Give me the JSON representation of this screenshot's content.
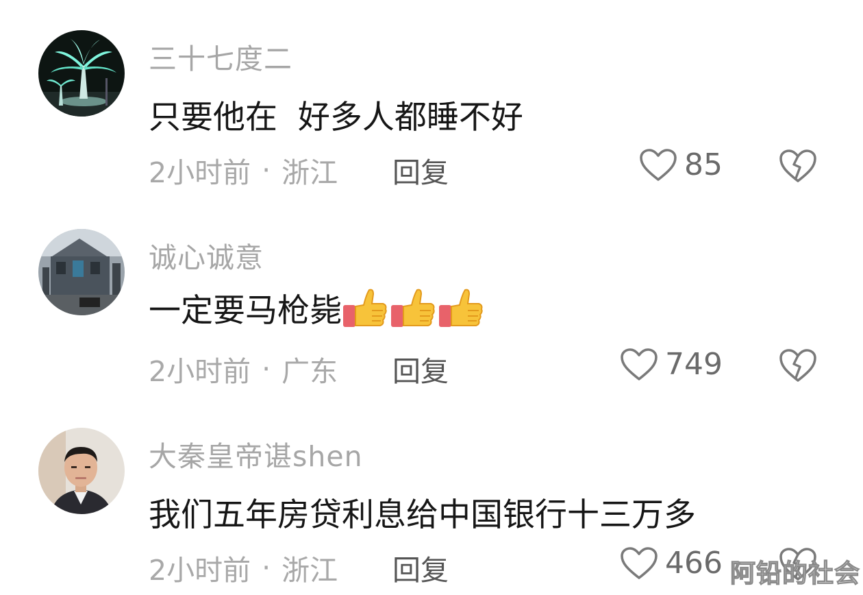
{
  "comments": [
    {
      "username": "三十七度二",
      "text": "只要他在  好多人都睡不好",
      "time": "2小时前",
      "location": "浙江",
      "reply_label": "回复",
      "likes": "85",
      "avatar": "palm-light-night-avatar"
    },
    {
      "username": "诚心诚意",
      "text": "一定要马枪毙",
      "emoji": [
        "thumbs-up",
        "thumbs-up",
        "thumbs-up"
      ],
      "time": "2小时前",
      "location": "广东",
      "reply_label": "回复",
      "likes": "749",
      "avatar": "building-photo-avatar"
    },
    {
      "username": "大秦皇帝谌shen",
      "text": "我们五年房贷利息给中国银行十三万多",
      "time": "2小时前",
      "location": "浙江",
      "reply_label": "回复",
      "likes": "466",
      "avatar": "man-portrait-avatar"
    }
  ],
  "separator": "·",
  "watermark": "阿铅的社会",
  "colors": {
    "username": "#a6a6a6",
    "text": "#161616",
    "meta": "#a8a8a8",
    "reply": "#555555",
    "icon": "#7a7a7a"
  }
}
